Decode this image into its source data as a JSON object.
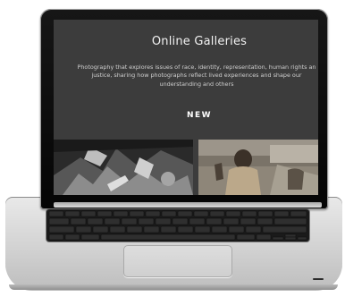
{
  "screen": {
    "title": "Online Galleries",
    "description": "Photography that explores issues of race, identity, representation, human rights an justice, sharing how photographs reflect lived experiences and shape our understanding and others",
    "section_label": "NEW"
  },
  "colors": {
    "screen_background": "#3c3c3c",
    "title_text": "#f2f2f2",
    "laptop_silver": "#d2d2d2",
    "bezel": "#0a0a0a"
  }
}
